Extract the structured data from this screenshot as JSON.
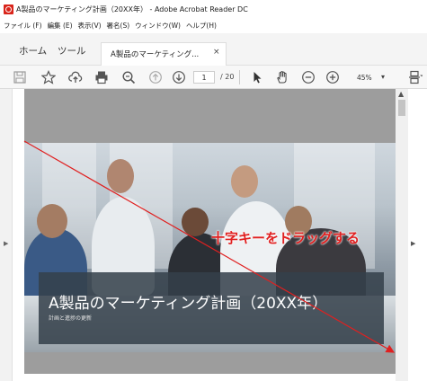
{
  "window": {
    "title": "A製品のマーケティング計画（20XX年） - Adobe Acrobat Reader DC"
  },
  "menu": {
    "items": [
      "ファイル (F)",
      "編集 (E)",
      "表示(V)",
      "署名(S)",
      "ウィンドウ(W)",
      "ヘルプ(H)"
    ]
  },
  "tabs": {
    "home": "ホーム",
    "tools": "ツール",
    "doc": "A製品のマーケティング...",
    "close": "×"
  },
  "toolbar": {
    "page_current": "1",
    "page_total": "/ 20",
    "zoom": "45%",
    "zoom_caret": "▾"
  },
  "slide": {
    "title": "A製品のマーケティング計画（20XX年）",
    "subtitle": "計画と進捗の更新"
  },
  "annotation": {
    "text": "十字キーをドラッグする",
    "color": "#e02020"
  },
  "icons": [
    "save-icon",
    "bookmark-star-icon",
    "cloud-upload-icon",
    "print-icon",
    "zoom-search-icon",
    "page-up-icon",
    "page-down-icon",
    "select-arrow-icon",
    "hand-tool-icon",
    "zoom-out-icon",
    "zoom-in-icon",
    "fit-page-icon"
  ]
}
